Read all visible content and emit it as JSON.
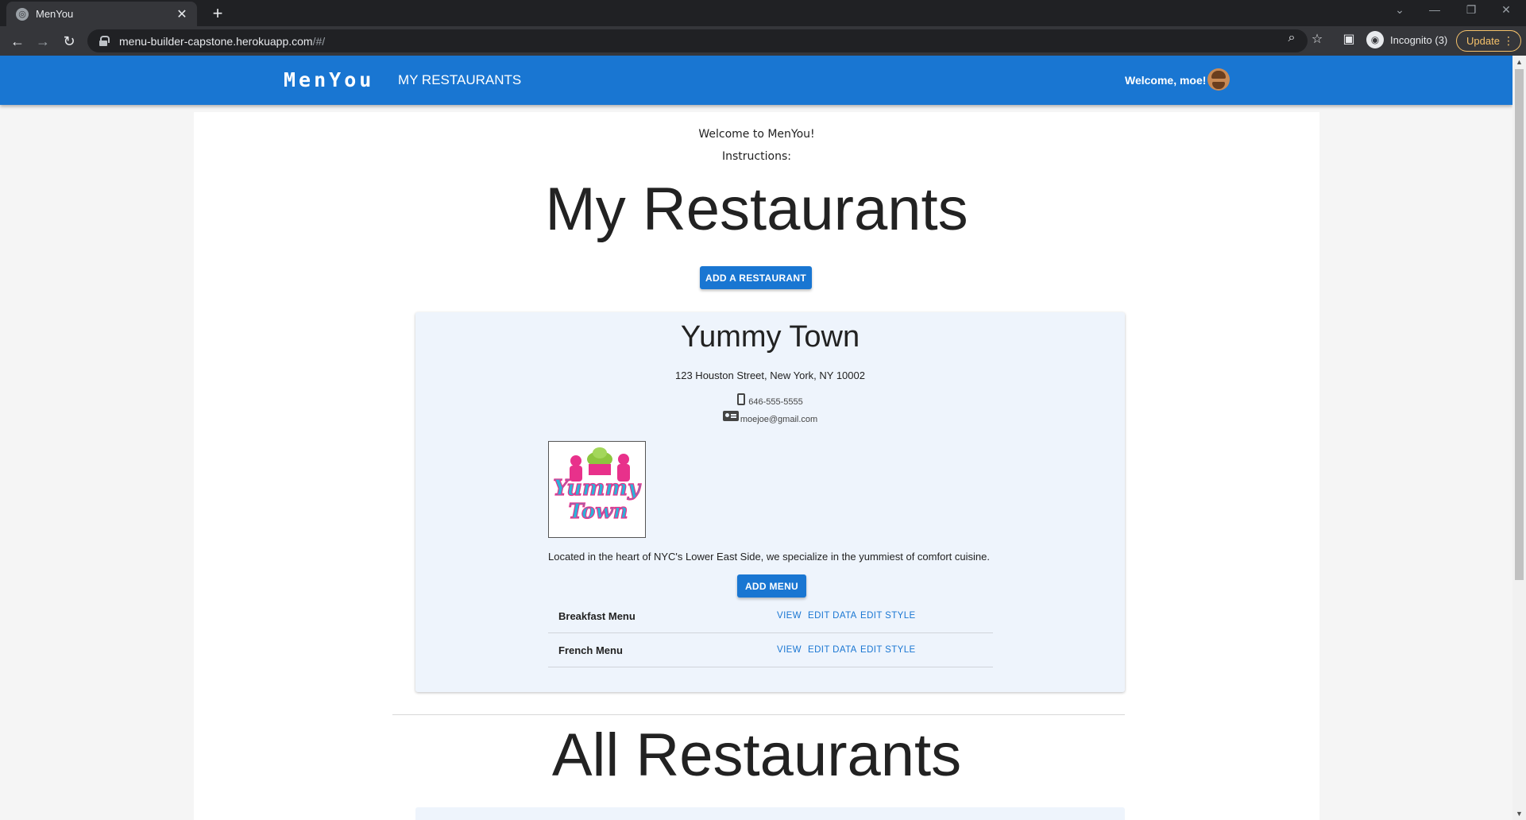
{
  "browser": {
    "tab_title": "MenYou",
    "tab_close": "✕",
    "new_tab": "+",
    "url_host": "menu-builder-capstone.herokuapp.com",
    "url_path": "/#/",
    "incognito_label": "Incognito (3)",
    "update_label": "Update",
    "icons": [
      "back-icon",
      "forward-icon",
      "reload-icon",
      "lock-icon",
      "zoom-icon",
      "star-icon",
      "sidepanel-icon",
      "incognito-icon",
      "kebab-icon"
    ]
  },
  "appbar": {
    "brand": "MenYou",
    "nav_my_restaurants": "MY RESTAURANTS",
    "welcome": "Welcome, moe!",
    "color": "#1976d2"
  },
  "main": {
    "welcome_text": "Welcome to MenYou!",
    "instructions": "Instructions:",
    "my_restaurants_heading": "My Restaurants",
    "add_restaurant_label": "ADD A RESTAURANT",
    "all_restaurants_heading": "All Restaurants"
  },
  "restaurant": {
    "name": "Yummy Town",
    "address": "123 Houston Street, New York, NY 10002",
    "phone": "646-555-5555",
    "email": "moejoe@gmail.com",
    "logo_text_1": "Yummy",
    "logo_text_2": "Town",
    "description": "Located in the heart of NYC's Lower East Side, we specialize in the yummiest of comfort cuisine.",
    "add_menu_label": "ADD MENU",
    "menus": [
      {
        "name": "Breakfast Menu",
        "view": "VIEW",
        "edit_data": "EDIT DATA",
        "edit_style": "EDIT STYLE"
      },
      {
        "name": "French Menu",
        "view": "VIEW",
        "edit_data": "EDIT DATA",
        "edit_style": "EDIT STYLE"
      }
    ]
  }
}
